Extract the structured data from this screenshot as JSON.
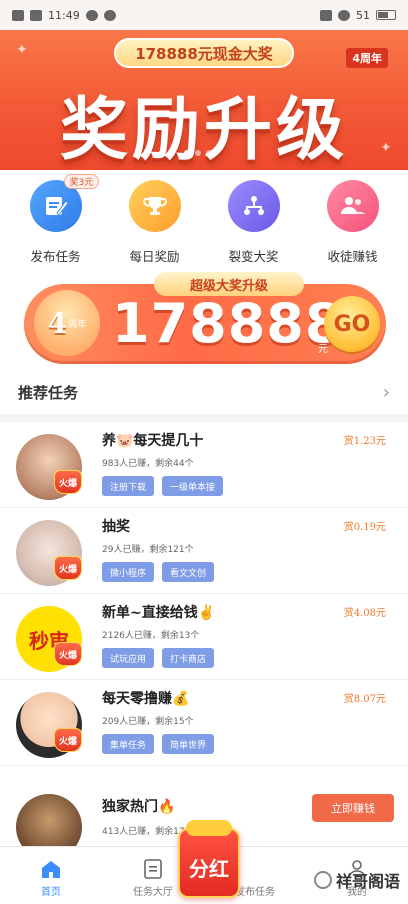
{
  "status_bar": {
    "time": "11:49",
    "battery": "51"
  },
  "hero": {
    "pill": "178888元现金大奖",
    "tag": "4周年",
    "title": "奖励升级"
  },
  "actions": [
    {
      "label": "发布任务",
      "badge": "奖3元",
      "color": "#3e8df1",
      "icon": "edit-icon"
    },
    {
      "label": "每日奖励",
      "color": "#ffb83a",
      "icon": "trophy-icon"
    },
    {
      "label": "裂变大奖",
      "color": "#7a6ef0",
      "icon": "network-icon"
    },
    {
      "label": "收徒赚钱",
      "color": "#ff6f8b",
      "icon": "users-icon"
    }
  ],
  "prize": {
    "top_label": "超级大奖升级",
    "year": "4",
    "year_small": "周年",
    "amount": "178888",
    "unit": "元",
    "go": "GO"
  },
  "section": {
    "title": "推荐任务"
  },
  "tasks": [
    {
      "title": "养🐷每天提几十",
      "meta": "983人已赚，剩余44个",
      "tags": [
        "注册下载",
        "一级单本接"
      ],
      "reward": "赏1.23元",
      "hot": "火爆"
    },
    {
      "title": "抽奖",
      "meta": "29人已赚，剩余121个",
      "tags": [
        "微小程序",
        "看文文创"
      ],
      "reward": "赏0.19元",
      "hot": "火爆"
    },
    {
      "title": "新单~直接给钱✌",
      "meta": "2126人已赚，剩余13个",
      "tags": [
        "试玩应用",
        "打卡商店"
      ],
      "reward": "赏4.08元",
      "hot": "火爆",
      "avatar_text": "秒审"
    },
    {
      "title": "每天零撸赚💰",
      "meta": "209人已赚，剩余15个",
      "tags": [
        "集单任务",
        "简单世界"
      ],
      "reward": "赏8.07元",
      "hot": "火爆"
    },
    {
      "title": "独家热门🔥",
      "meta": "413人已赚，剩余17个",
      "tags": [],
      "button": "立即赚钱"
    }
  ],
  "tabbar": [
    {
      "label": "首页",
      "active": true
    },
    {
      "label": "任务大厅",
      "active": false
    },
    {
      "label": "发布任务",
      "active": false
    },
    {
      "label": "我的",
      "active": false
    }
  ],
  "fab": "分红",
  "watermark": "祥哥阁语"
}
